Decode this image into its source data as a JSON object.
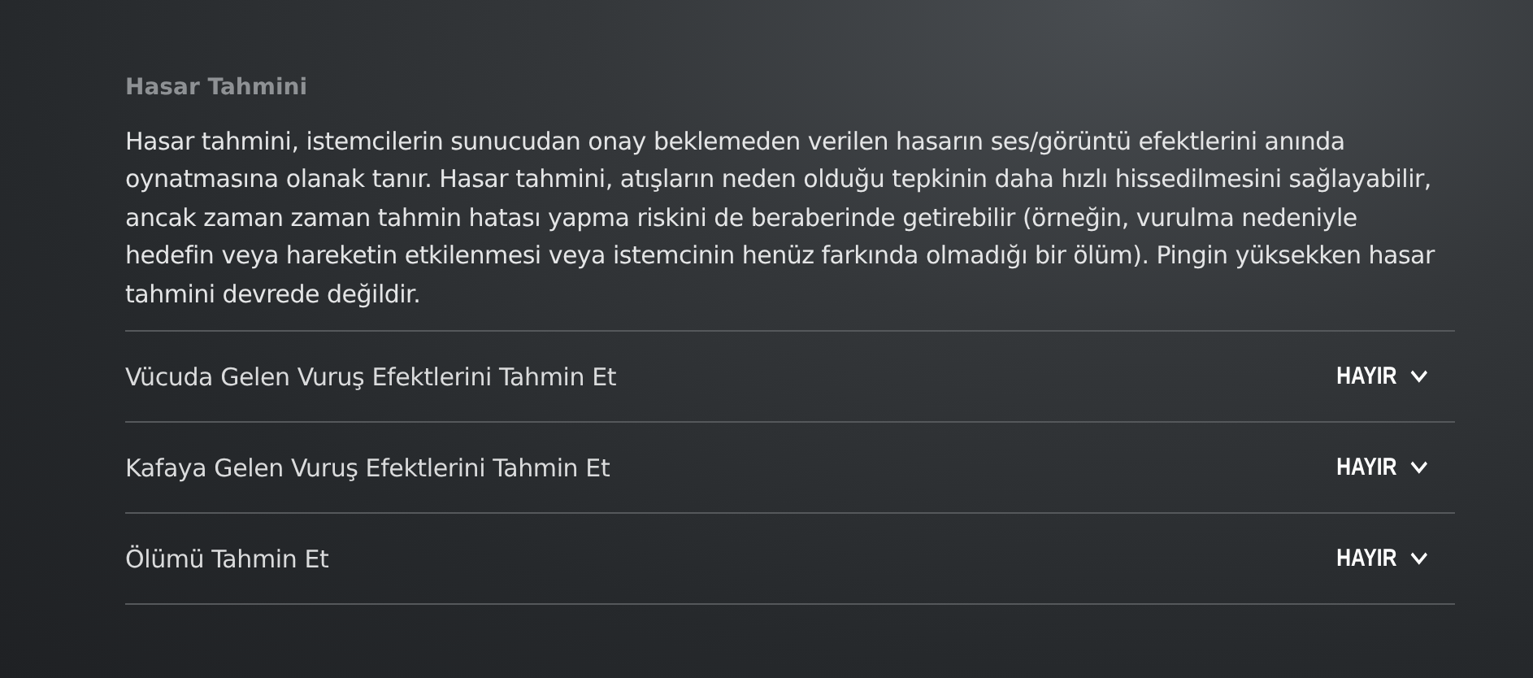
{
  "section": {
    "title": "Hasar Tahmini",
    "description": "Hasar tahmini, istemcilerin sunucudan onay beklemeden verilen hasarın ses/görüntü efektlerini anında oynatmasına olanak tanır. Hasar tahmini, atışların neden olduğu tepkinin daha hızlı hissedilmesini sağlayabilir, ancak zaman zaman tahmin hatası yapma riskini de beraberinde getirebilir (örneğin, vurulma nedeniyle hedefin veya hareketin etkilenmesi veya istemcinin henüz farkında olmadığı bir ölüm). Pingin yüksekken hasar tahmini devrede değildir."
  },
  "settings": [
    {
      "label": "Vücuda Gelen Vuruş Efektlerini Tahmin Et",
      "value": "HAYIR"
    },
    {
      "label": "Kafaya Gelen Vuruş Efektlerini Tahmin Et",
      "value": "HAYIR"
    },
    {
      "label": "Ölümü Tahmin Et",
      "value": "HAYIR"
    }
  ]
}
